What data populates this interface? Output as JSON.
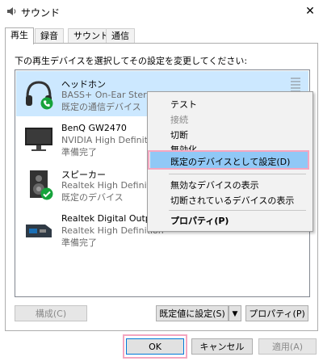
{
  "window": {
    "title": "サウンド",
    "close_glyph": "✕"
  },
  "tabs": [
    {
      "label": "再生",
      "active": true
    },
    {
      "label": "録音",
      "active": false
    },
    {
      "label": "サウンド",
      "active": false
    },
    {
      "label": "通信",
      "active": false
    }
  ],
  "instruction": "下の再生デバイスを選択してその設定を変更してください:",
  "devices": [
    {
      "name": "ヘッドホン",
      "desc": "BASS+ On-Ear Stereo",
      "status": "既定の通信デバイス",
      "icon": "headphones-icon",
      "badge": "phone-badge-icon",
      "selected": true
    },
    {
      "name": "BenQ GW2470",
      "desc": "NVIDIA High Definition",
      "status": "準備完了",
      "icon": "monitor-icon"
    },
    {
      "name": "スピーカー",
      "desc": "Realtek High Definition",
      "status": "既定のデバイス",
      "icon": "speaker-icon",
      "badge": "check-badge-icon"
    },
    {
      "name": "Realtek Digital Output",
      "desc": "Realtek High Definition",
      "status": "準備完了",
      "icon": "digital-output-icon"
    }
  ],
  "context_menu": {
    "items": [
      {
        "label": "テスト",
        "disabled": false
      },
      {
        "label": "接続",
        "disabled": true
      },
      {
        "label": "切断",
        "disabled": false
      },
      {
        "label": "無効化",
        "disabled": false
      },
      {
        "label": "既定のデバイスとして設定(D)",
        "highlighted": true
      },
      {
        "label": "無効なデバイスの表示"
      },
      {
        "label": "切断されているデバイスの表示"
      },
      {
        "label": "プロパティ(P)",
        "bold": true
      }
    ]
  },
  "buttons": {
    "configure": "構成(C)",
    "set_default": "既定値に設定(S)",
    "dropdown_arrow": "▼",
    "properties": "プロパティ(P)",
    "ok": "OK",
    "cancel": "キャンセル",
    "apply": "適用(A)"
  },
  "colors": {
    "selection": "#cce8ff",
    "menu_highlight": "#90c8f6",
    "annotation": "#f4a6c0",
    "badge_green": "#16a33b"
  }
}
